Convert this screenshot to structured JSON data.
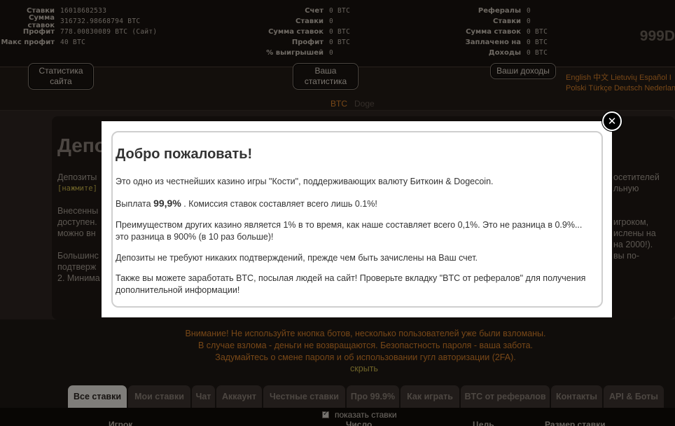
{
  "header": {
    "site_stats": [
      {
        "label": "Ставки",
        "value": "16018682533"
      },
      {
        "label": "Сумма ставок",
        "value": "316732.98668794 BTC"
      },
      {
        "label": "Профит",
        "value": "778.00830089 BTC (Сайт)"
      },
      {
        "label": "Макс профит",
        "value": "40 BTC"
      }
    ],
    "user_stats": [
      {
        "label": "Счет",
        "value": "0 BTC"
      },
      {
        "label": "Ставки",
        "value": "0"
      },
      {
        "label": "Сумма ставок",
        "value": "0 BTC"
      },
      {
        "label": "Профит",
        "value": "0 BTC"
      },
      {
        "label": "% выигрышей",
        "value": "0"
      }
    ],
    "ref_stats": [
      {
        "label": "Рефералы",
        "value": "0"
      },
      {
        "label": "Ставки",
        "value": "0"
      },
      {
        "label": "Сумма ставок",
        "value": "0 BTC"
      },
      {
        "label": "Заплачено на",
        "value": "0 BTC"
      },
      {
        "label": "Доходы",
        "value": "0 BTC"
      }
    ],
    "brand": "999D"
  },
  "buttons": {
    "site_stats_line1": "Статистика",
    "site_stats_line2": "сайта",
    "your_stats_line1": "Ваша",
    "your_stats_line2": "статистика",
    "your_income": "Ваши доходы"
  },
  "languages_row1": [
    "English",
    "中文",
    "Lietuvių",
    "Español",
    "I"
  ],
  "languages_row2": [
    "Polski",
    "Türkçe",
    "Deutsch",
    "Nederlan"
  ],
  "coins": {
    "active": "BTC",
    "inactive": "Doge"
  },
  "background_panel": {
    "title": "Депо",
    "line1": "Депозиты",
    "click": "[нажмите]",
    "line2a": "Внесенны",
    "line2b": "доступен.",
    "line2c": "можно вн",
    "line3a": "Большинс",
    "line3b": "подтверж",
    "line3c": "2. Минима",
    "right1": "осетителей",
    "right2": "льную",
    "right3": "игроком,",
    "right4": "ислены на",
    "right5": "на 2000!).",
    "right6": "вы по-"
  },
  "modal": {
    "title": "Добро пожаловать!",
    "p1": "Это одно из честнейших казино игры \"Кости\", поддерживающих валюту Биткоин & Dogecoin.",
    "p2_before": "Выплата ",
    "p2_strong": "99,9%",
    "p2_after": " . Комиссия ставок составляет всего лишь 0.1%!",
    "p3": "Преимуществом других казино является 1% в то время, как наше составляет всего 0,1%. Это не разница в 0.9%... это разница в 900% (в 10 раз больше)!",
    "p4": "Депозиты не требуют никаких подтверждений, прежде чем быть зачислены на Ваш счет.",
    "p5": "Также вы можете заработать BTC, посылая людей на сайт! Проверьте вкладку \"BTC от рефералов\" для получения дополнительной информации!",
    "close_symbol": "✕"
  },
  "warning": {
    "text": "Внимание! Не используйте кнопка ботов, несколько пользователей уже были взломаны. В случае взлома - деньги не возвращаются. Безопастность пароля - ваша забота. Задумайтесь о смене пароля и об использовании гугл авторизации (2FA).",
    "hide": "скрыть"
  },
  "tabs": [
    "Все ставки",
    "Мои ставки",
    "Чат",
    "Аккаунт",
    "Честные ставки",
    "Про 99.9%",
    "Как играть",
    "BTC от рефералов",
    "Контакты",
    "API & Боты"
  ],
  "bets_area": {
    "show_bets": "показать ставки",
    "col_player": "Игрок",
    "col_number": "Число",
    "col_goal": "Цель",
    "col_bet_size": "Размер ставки"
  },
  "colors": {
    "accent_orange": "#d9822b",
    "link_yellow": "#c9b44a"
  }
}
